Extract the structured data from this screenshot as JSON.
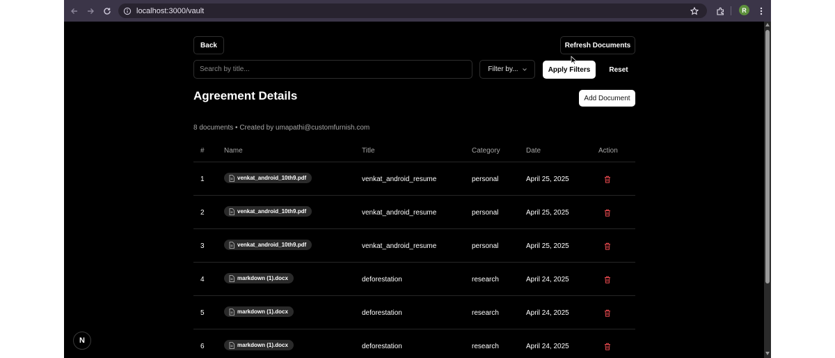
{
  "browser": {
    "url": "localhost:3000/vault",
    "avatar_letter": "R"
  },
  "page": {
    "back_label": "Back",
    "refresh_label": "Refresh Documents",
    "search_placeholder": "Search by title...",
    "filter_label": "Filter by...",
    "apply_label": "Apply Filters",
    "reset_label": "Reset",
    "title": "Agreement Details",
    "add_label": "Add Document",
    "meta": "8 documents  •  Created by umapathi@customfurnish.com"
  },
  "table": {
    "headers": [
      "#",
      "Name",
      "Title",
      "Category",
      "Date",
      "Action"
    ],
    "rows": [
      {
        "num": "1",
        "name": "venkat_android_10th9.pdf",
        "title": "venkat_android_resume",
        "category": "personal",
        "date": "April 25, 2025"
      },
      {
        "num": "2",
        "name": "venkat_android_10th9.pdf",
        "title": "venkat_android_resume",
        "category": "personal",
        "date": "April 25, 2025"
      },
      {
        "num": "3",
        "name": "venkat_android_10th9.pdf",
        "title": "venkat_android_resume",
        "category": "personal",
        "date": "April 25, 2025"
      },
      {
        "num": "4",
        "name": "markdown (1).docx",
        "title": "deforestation",
        "category": "research",
        "date": "April 24, 2025"
      },
      {
        "num": "5",
        "name": "markdown (1).docx",
        "title": "deforestation",
        "category": "research",
        "date": "April 24, 2025"
      },
      {
        "num": "6",
        "name": "markdown (1).docx",
        "title": "deforestation",
        "category": "research",
        "date": "April 24, 2025"
      }
    ]
  },
  "badge_letter": "N",
  "colors": {
    "delete": "#e5484d",
    "toolbar": "#3b3548"
  }
}
